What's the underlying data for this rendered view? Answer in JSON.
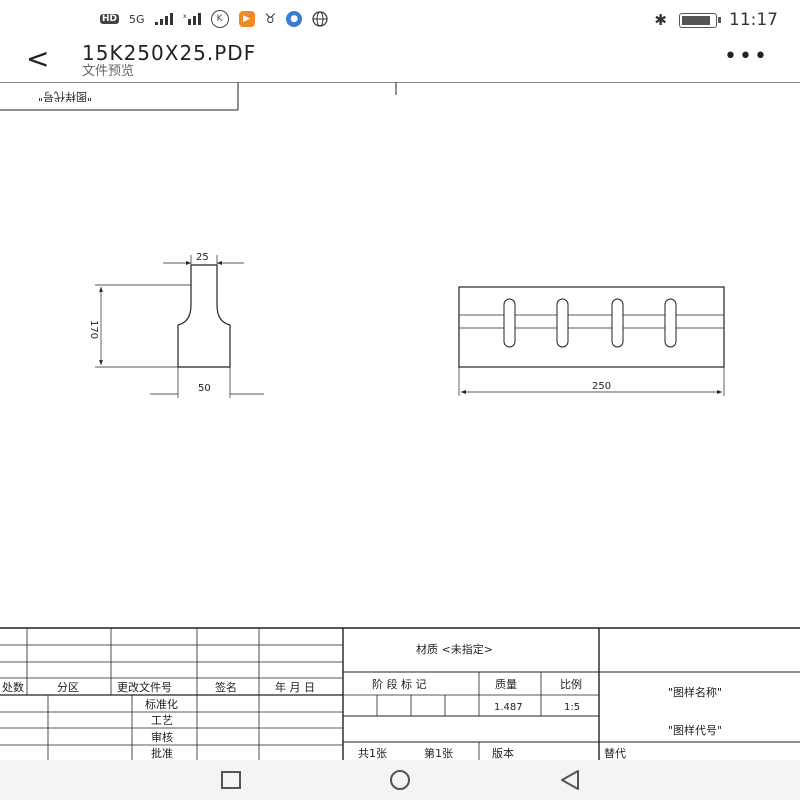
{
  "status_bar": {
    "time": "11:17",
    "battery_level": 0.9,
    "network_label": "5G",
    "icons": [
      "hd-icon",
      "signal-icon",
      "no-signal-icon",
      "k-app-icon",
      "video-app-icon",
      "notification-icon",
      "browser-icon",
      "bluetooth-icon",
      "battery-icon"
    ]
  },
  "header": {
    "title": "15K250X25.PDF",
    "subtitle": "文件预览",
    "back_glyph": "<",
    "more_glyph": "•••"
  },
  "drawing": {
    "top_label": "\"图样代号\"",
    "front_view": {
      "dim_width_top": "25",
      "dim_height": "170",
      "dim_width_bottom": "50"
    },
    "side_view": {
      "dim_width": "250",
      "slot_count": 4
    }
  },
  "title_block": {
    "rev_headers": [
      "处数",
      "分区",
      "更改文件号",
      "签名",
      "年 月 日"
    ],
    "approval_labels": [
      "标准化",
      "工艺",
      "审核",
      "批准"
    ],
    "material": "材质 <未指定>",
    "stage_label": "阶 段 标 记",
    "mass_label": "质量",
    "scale_label": "比例",
    "mass_value": "1.487",
    "scale_value": "1:5",
    "sheet_total": "共1张",
    "sheet_no": "第1张",
    "version_label": "版本",
    "replace_label": "替代",
    "drawing_name": "\"图样名称\"",
    "drawing_code": "\"图样代号\""
  },
  "nav": {
    "icons": [
      "recent-apps-icon",
      "home-icon",
      "back-triangle-icon"
    ]
  }
}
